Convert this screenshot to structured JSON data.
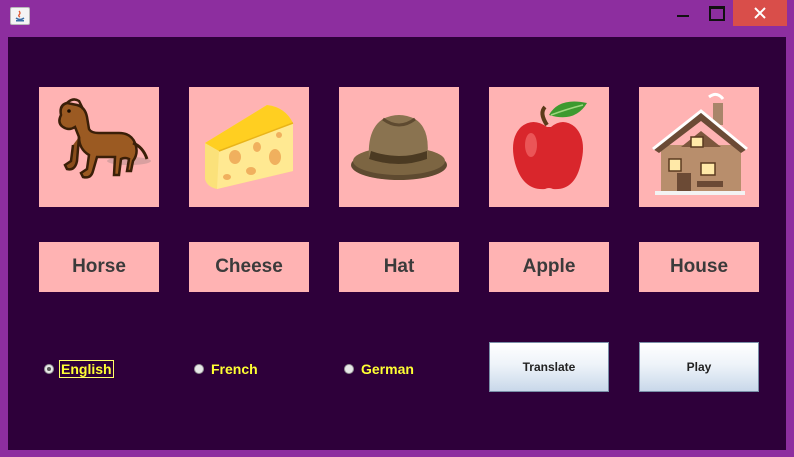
{
  "window": {
    "controls": [
      "minimize-icon",
      "maximize-icon",
      "close-icon"
    ]
  },
  "words": [
    {
      "label": "Horse",
      "icon": "horse-icon"
    },
    {
      "label": "Cheese",
      "icon": "cheese-icon"
    },
    {
      "label": "Hat",
      "icon": "hat-icon"
    },
    {
      "label": "Apple",
      "icon": "apple-icon"
    },
    {
      "label": "House",
      "icon": "house-icon"
    }
  ],
  "languages": {
    "options": [
      "English",
      "French",
      "German"
    ],
    "selected": "English"
  },
  "buttons": {
    "translate": "Translate",
    "play": "Play"
  },
  "colors": {
    "window_frame": "#8d2e9f",
    "background": "#2e003a",
    "tile": "#ffb3b3",
    "radio_label": "#ffff33",
    "close_button": "#d94e4a"
  }
}
